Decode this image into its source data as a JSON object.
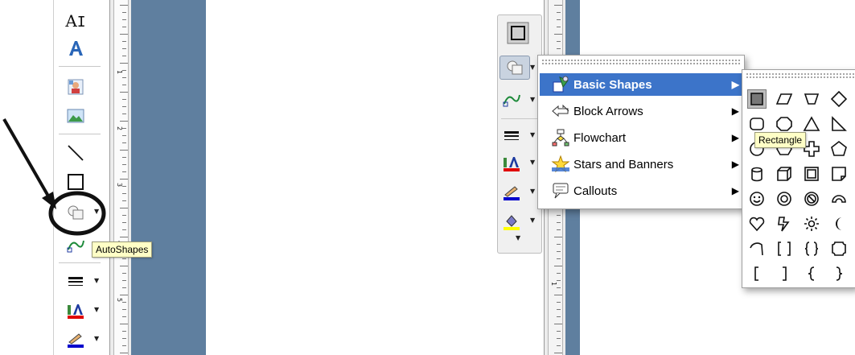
{
  "left_tooltip": "AutoShapes",
  "right_tooltip": "Rectangle",
  "left_toolbar": {
    "text_tool_label": "A",
    "ruler_numbers": [
      "1",
      "2",
      "3",
      "4",
      "5"
    ]
  },
  "right_ruler_numbers": [
    "1"
  ],
  "menu": {
    "items": [
      {
        "label": "Basic Shapes",
        "icon": "basic-shapes-icon",
        "active": true
      },
      {
        "label": "Block Arrows",
        "icon": "block-arrows-icon",
        "active": false
      },
      {
        "label": "Flowchart",
        "icon": "flowchart-icon",
        "active": false
      },
      {
        "label": "Stars and Banners",
        "icon": "stars-banners-icon",
        "active": false
      },
      {
        "label": "Callouts",
        "icon": "callouts-icon",
        "active": false
      }
    ]
  },
  "palette": {
    "selected": "rectangle",
    "shapes": [
      "rectangle",
      "parallelogram",
      "trapezoid",
      "diamond",
      "rounded-rectangle",
      "octagon",
      "isosceles-triangle",
      "right-triangle",
      "oval",
      "hexagon",
      "cross",
      "pentagon",
      "can",
      "cube",
      "frame",
      "folded-corner",
      "smiley-face",
      "donut",
      "no-symbol",
      "block-arc",
      "heart",
      "lightning-bolt",
      "sun",
      "moon",
      "arc",
      "double-bracket",
      "double-brace",
      "plaque",
      "left-bracket",
      "right-bracket",
      "left-brace",
      "right-brace"
    ]
  },
  "colors": {
    "panel_blue": "#5f7f9f",
    "menu_highlight": "#3c74c9",
    "tooltip_bg": "#ffffc6",
    "font_red": "#e00000",
    "line_blue": "#0000cc",
    "fill_yellow": "#ffff00"
  }
}
